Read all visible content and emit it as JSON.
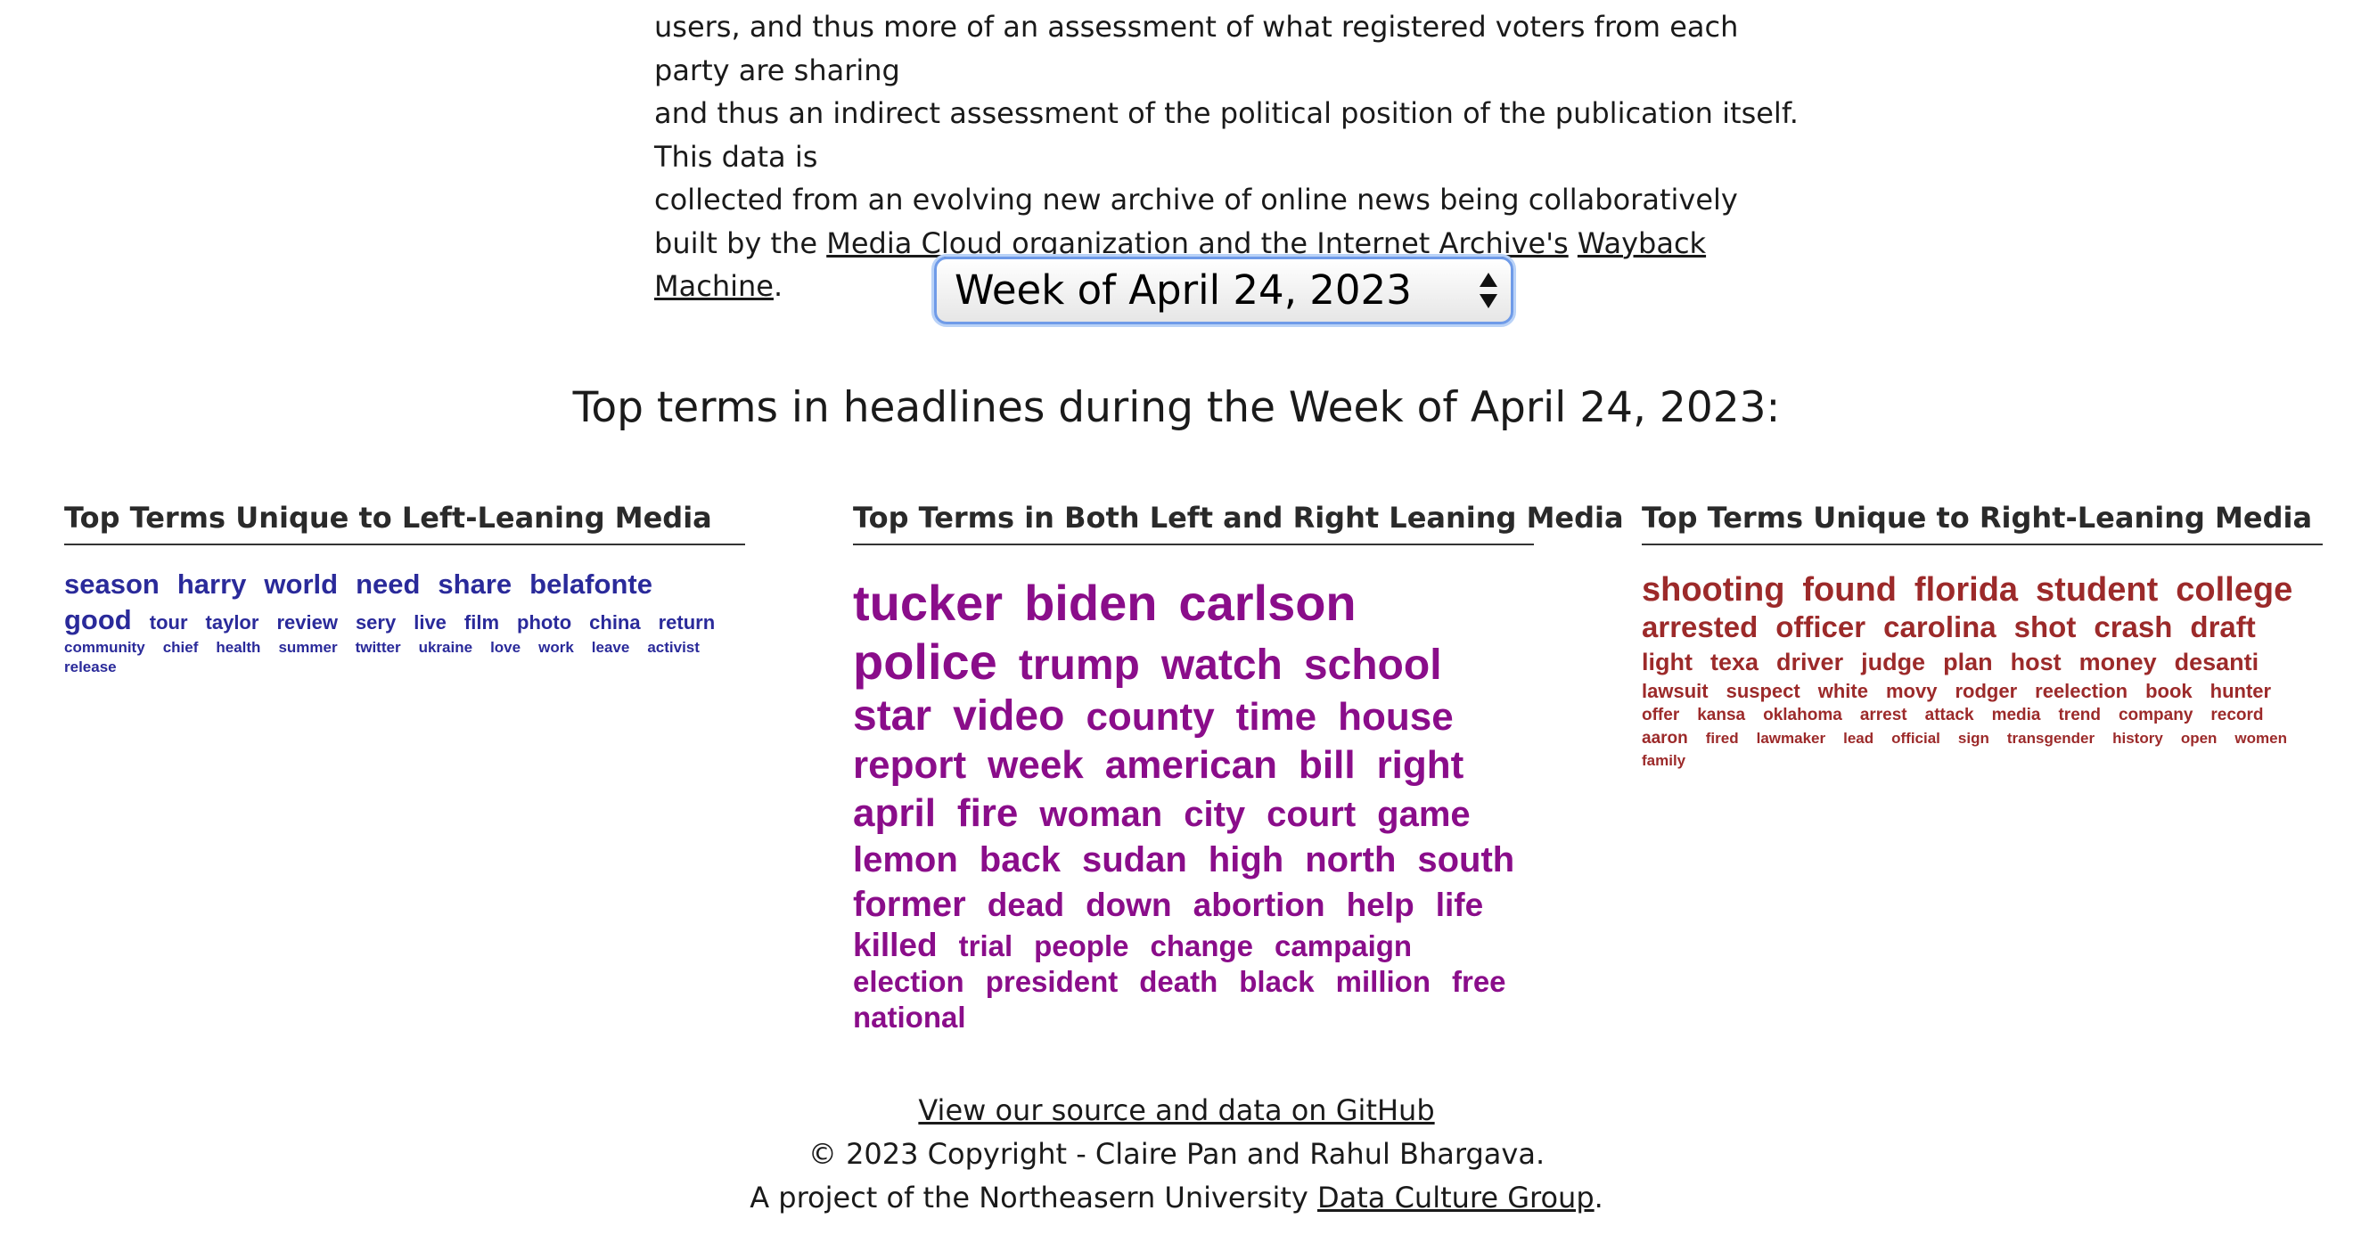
{
  "intro": {
    "line1": "users, and thus more of an assessment of what registered voters from each party are sharing",
    "line2": "and thus an indirect assessment of the political position of the publication itself. This data is",
    "line3_pre": "collected from an evolving new archive of online news being collaboratively built by the ",
    "link_media_cloud": "Media Cloud",
    "mid": " organization and the ",
    "link_internet_archive": "Internet Archive's",
    "link_wayback": "Wayback Machine",
    "end": "."
  },
  "week_select": {
    "selected": "Week of April 24, 2023"
  },
  "headline": "Top terms in headlines during the Week of April 24, 2023:",
  "columns": {
    "left_title": "Top Terms Unique to Left-Leaning Media",
    "both_title": "Top Terms in Both Left and Right Leaning Media",
    "right_title": "Top Terms Unique to Right-Leaning Media"
  },
  "colors": {
    "left": "#2a2a9a",
    "both": "#8a0d8a",
    "right": "#9c2a2a"
  },
  "left_terms": [
    "season",
    "harry",
    "world",
    "need",
    "share",
    "belafonte",
    "good",
    "tour",
    "taylor",
    "review",
    "sery",
    "live",
    "film",
    "photo",
    "china",
    "return",
    "community",
    "chief",
    "health",
    "summer",
    "twitter",
    "ukraine",
    "love",
    "work",
    "leave",
    "activist",
    "release"
  ],
  "both_terms": [
    "tucker",
    "biden",
    "carlson",
    "police",
    "trump",
    "watch",
    "school",
    "star",
    "video",
    "county",
    "time",
    "house",
    "report",
    "week",
    "american",
    "bill",
    "right",
    "april",
    "fire",
    "woman",
    "city",
    "court",
    "game",
    "lemon",
    "back",
    "sudan",
    "high",
    "north",
    "south",
    "former",
    "dead",
    "down",
    "abortion",
    "help",
    "life",
    "killed",
    "trial",
    "people",
    "change",
    "campaign",
    "election",
    "president",
    "death",
    "black",
    "million",
    "free",
    "national"
  ],
  "right_terms": [
    "shooting",
    "found",
    "florida",
    "student",
    "college",
    "arrested",
    "officer",
    "carolina",
    "shot",
    "crash",
    "draft",
    "light",
    "texa",
    "driver",
    "judge",
    "plan",
    "host",
    "money",
    "desanti",
    "lawsuit",
    "suspect",
    "white",
    "movy",
    "rodger",
    "reelection",
    "book",
    "hunter",
    "offer",
    "kansa",
    "oklahoma",
    "arrest",
    "attack",
    "media",
    "trend",
    "company",
    "record",
    "aaron",
    "fired",
    "lawmaker",
    "lead",
    "official",
    "sign",
    "transgender",
    "history",
    "open",
    "women",
    "family"
  ],
  "footer": {
    "github_link": "View our source and data on GitHub",
    "copyright": "© 2023 Copyright - Claire Pan and Rahul Bhargava.",
    "project_pre": "A project of the Northeasern University ",
    "dcg_link": "Data Culture Group",
    "project_end": "."
  }
}
